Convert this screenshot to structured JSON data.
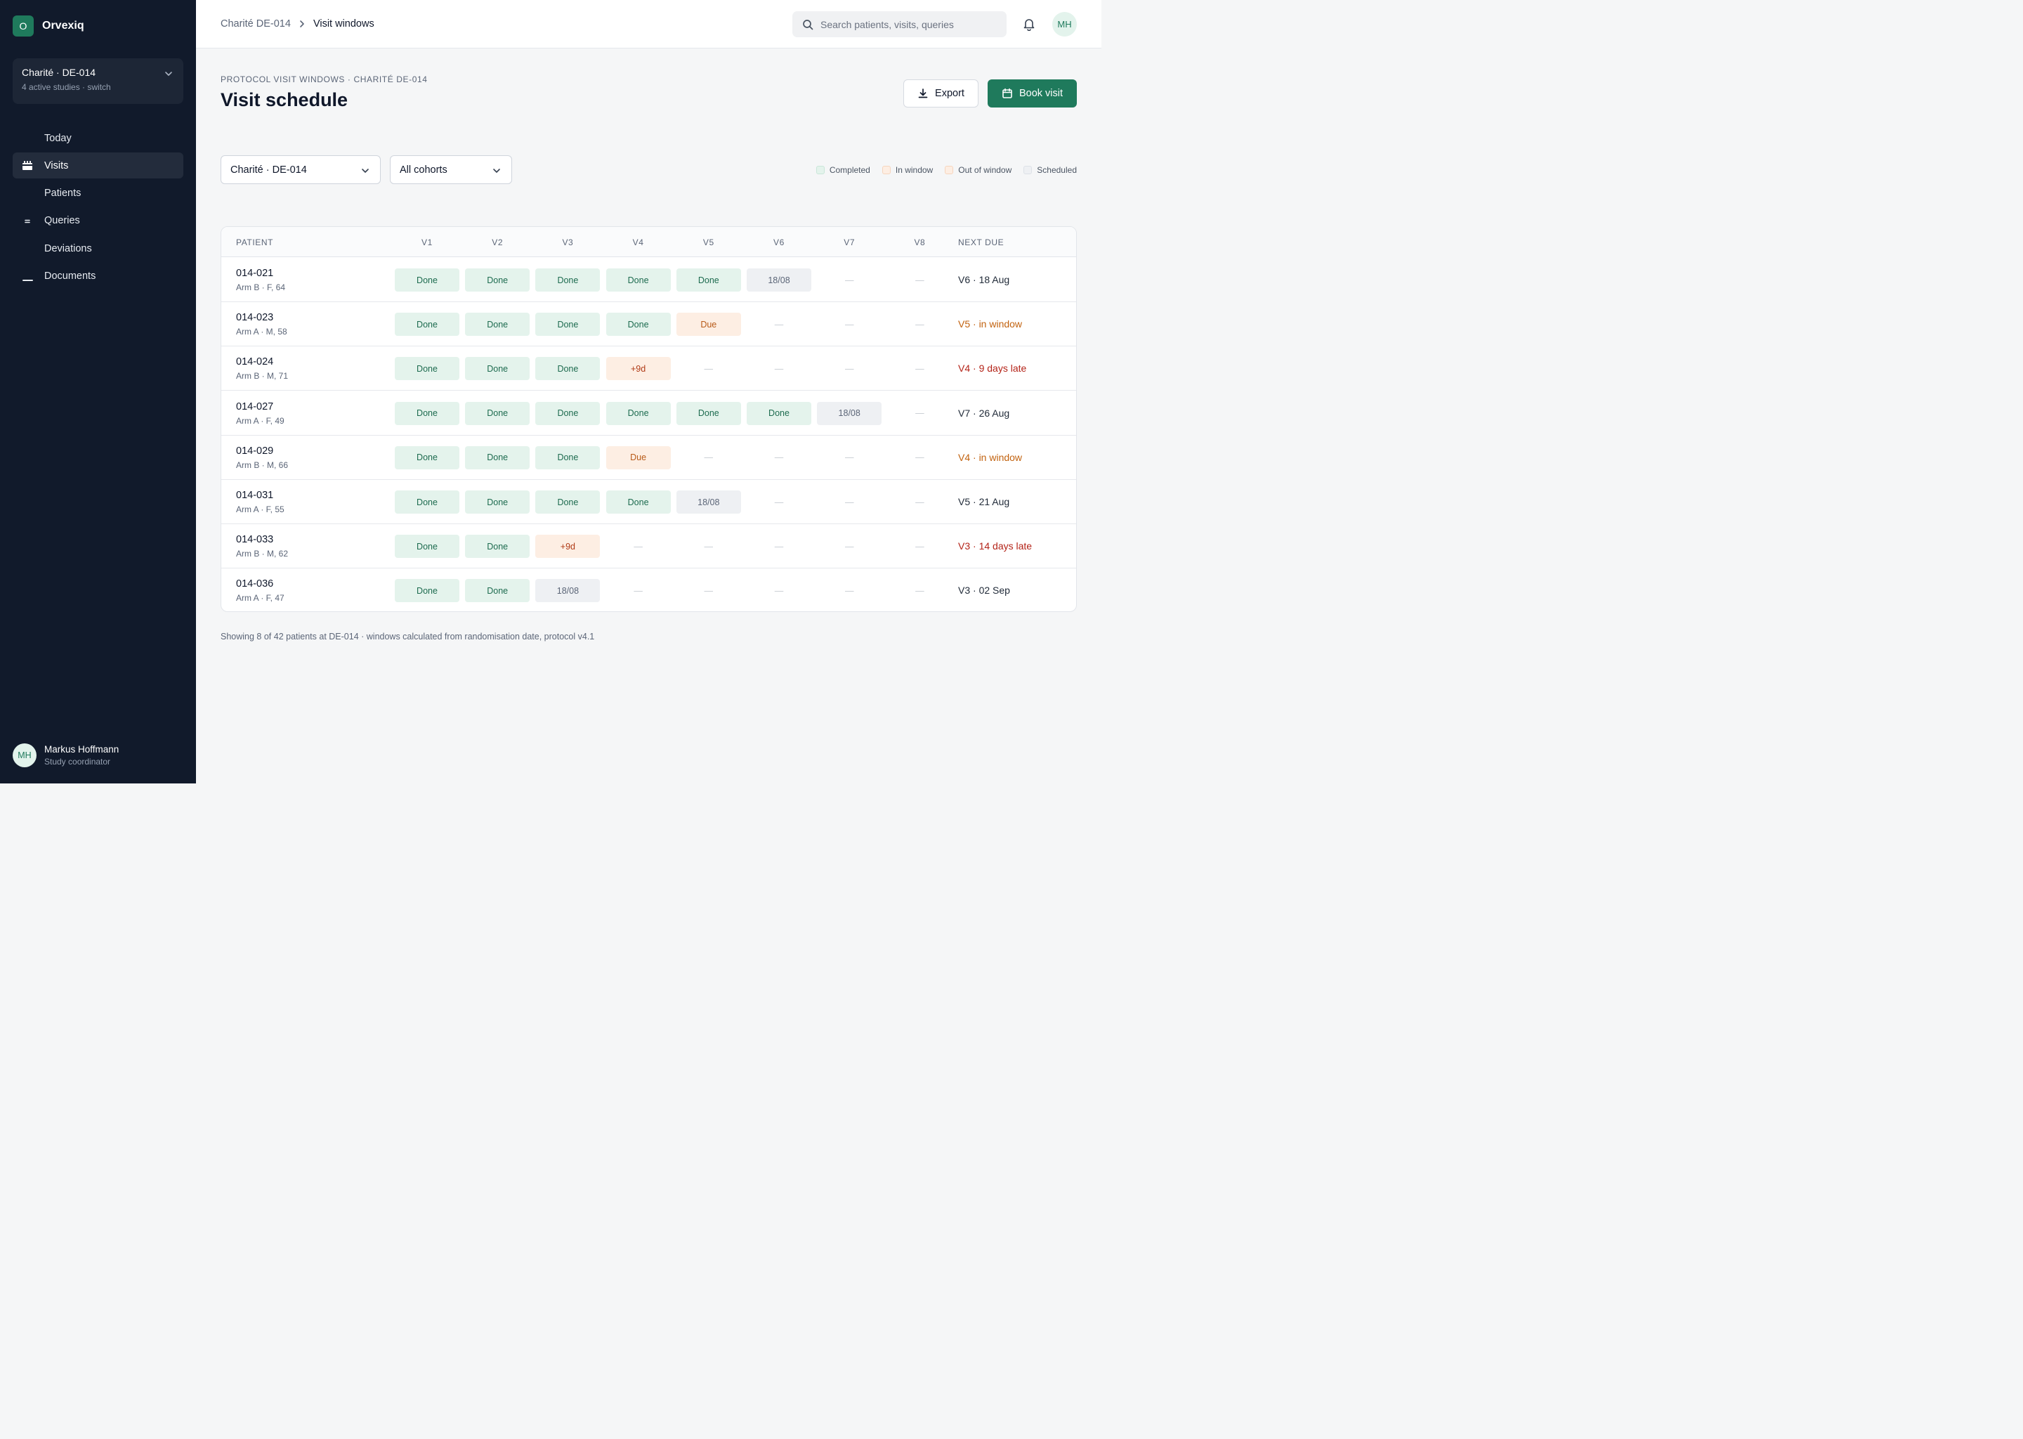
{
  "app": {
    "logo_letter": "O",
    "name": "Orvexiq"
  },
  "site_switcher": {
    "name": "Charité · DE-014",
    "subtitle": "4 active studies · switch"
  },
  "nav": [
    {
      "label": "Today",
      "icon": "",
      "active": false
    },
    {
      "label": "Visits",
      "icon": "calendar-icon",
      "active": true
    },
    {
      "label": "Patients",
      "icon": "",
      "active": false
    },
    {
      "label": "Queries",
      "icon": "equals-icon",
      "active": false
    },
    {
      "label": "Deviations",
      "icon": "",
      "active": false
    },
    {
      "label": "Documents",
      "icon": "underline-icon",
      "active": false
    }
  ],
  "user": {
    "initials": "MH",
    "name": "Markus Hoffmann",
    "role": "Study coordinator"
  },
  "topbar": {
    "breadcrumb_parent": "Charité DE-014",
    "breadcrumb_current": "Visit windows",
    "search_placeholder": "Search patients, visits, queries",
    "avatar_initials": "MH"
  },
  "page": {
    "eyebrow": "PROTOCOL VISIT WINDOWS · CHARITÉ DE-014",
    "title": "Visit schedule",
    "export_label": "Export",
    "book_label": "Book visit"
  },
  "filters": {
    "site": "Charité · DE-014",
    "cohort": "All cohorts"
  },
  "legend": [
    {
      "label": "Completed",
      "fill": "#e4f3ec",
      "border": "#c9e6d8"
    },
    {
      "label": "In window",
      "fill": "#fdeee3",
      "border": "#f6d5bd"
    },
    {
      "label": "Out of window",
      "fill": "#fdeee3",
      "border": "#f6d5bd"
    },
    {
      "label": "Scheduled",
      "fill": "#eef0f3",
      "border": "#dde1e7"
    }
  ],
  "table": {
    "headers": {
      "patient": "PATIENT",
      "visits": [
        "V1",
        "V2",
        "V3",
        "V4",
        "V5",
        "V6",
        "V7",
        "V8"
      ],
      "next_due": "NEXT DUE"
    },
    "rows": [
      {
        "id": "014-021",
        "meta": "Arm B · F, 64",
        "cells": [
          [
            "Done",
            "done"
          ],
          [
            "Done",
            "done"
          ],
          [
            "Done",
            "done"
          ],
          [
            "Done",
            "done"
          ],
          [
            "Done",
            "done"
          ],
          [
            "18/08",
            "sched"
          ],
          [
            "—",
            "none"
          ],
          [
            "—",
            "none"
          ]
        ],
        "next_due": "V6 · 18 Aug",
        "next_due_status": "normal"
      },
      {
        "id": "014-023",
        "meta": "Arm A · M, 58",
        "cells": [
          [
            "Done",
            "done"
          ],
          [
            "Done",
            "done"
          ],
          [
            "Done",
            "done"
          ],
          [
            "Done",
            "done"
          ],
          [
            "Due",
            "due"
          ],
          [
            "—",
            "none"
          ],
          [
            "—",
            "none"
          ],
          [
            "—",
            "none"
          ]
        ],
        "next_due": "V5 · in window",
        "next_due_status": "window"
      },
      {
        "id": "014-024",
        "meta": "Arm B · M, 71",
        "cells": [
          [
            "Done",
            "done"
          ],
          [
            "Done",
            "done"
          ],
          [
            "Done",
            "done"
          ],
          [
            "+9d",
            "late"
          ],
          [
            "—",
            "none"
          ],
          [
            "—",
            "none"
          ],
          [
            "—",
            "none"
          ],
          [
            "—",
            "none"
          ]
        ],
        "next_due": "V4 · 9 days late",
        "next_due_status": "late"
      },
      {
        "id": "014-027",
        "meta": "Arm A · F, 49",
        "cells": [
          [
            "Done",
            "done"
          ],
          [
            "Done",
            "done"
          ],
          [
            "Done",
            "done"
          ],
          [
            "Done",
            "done"
          ],
          [
            "Done",
            "done"
          ],
          [
            "Done",
            "done"
          ],
          [
            "18/08",
            "sched"
          ],
          [
            "—",
            "none"
          ]
        ],
        "next_due": "V7 · 26 Aug",
        "next_due_status": "normal"
      },
      {
        "id": "014-029",
        "meta": "Arm B · M, 66",
        "cells": [
          [
            "Done",
            "done"
          ],
          [
            "Done",
            "done"
          ],
          [
            "Done",
            "done"
          ],
          [
            "Due",
            "due"
          ],
          [
            "—",
            "none"
          ],
          [
            "—",
            "none"
          ],
          [
            "—",
            "none"
          ],
          [
            "—",
            "none"
          ]
        ],
        "next_due": "V4 · in window",
        "next_due_status": "window"
      },
      {
        "id": "014-031",
        "meta": "Arm A · F, 55",
        "cells": [
          [
            "Done",
            "done"
          ],
          [
            "Done",
            "done"
          ],
          [
            "Done",
            "done"
          ],
          [
            "Done",
            "done"
          ],
          [
            "18/08",
            "sched"
          ],
          [
            "—",
            "none"
          ],
          [
            "—",
            "none"
          ],
          [
            "—",
            "none"
          ]
        ],
        "next_due": "V5 · 21 Aug",
        "next_due_status": "normal"
      },
      {
        "id": "014-033",
        "meta": "Arm B · M, 62",
        "cells": [
          [
            "Done",
            "done"
          ],
          [
            "Done",
            "done"
          ],
          [
            "+9d",
            "late"
          ],
          [
            "—",
            "none"
          ],
          [
            "—",
            "none"
          ],
          [
            "—",
            "none"
          ],
          [
            "—",
            "none"
          ],
          [
            "—",
            "none"
          ]
        ],
        "next_due": "V3 · 14 days late",
        "next_due_status": "late"
      },
      {
        "id": "014-036",
        "meta": "Arm A · F, 47",
        "cells": [
          [
            "Done",
            "done"
          ],
          [
            "Done",
            "done"
          ],
          [
            "18/08",
            "sched"
          ],
          [
            "—",
            "none"
          ],
          [
            "—",
            "none"
          ],
          [
            "—",
            "none"
          ],
          [
            "—",
            "none"
          ],
          [
            "—",
            "none"
          ]
        ],
        "next_due": "V3 · 02 Sep",
        "next_due_status": "normal"
      }
    ]
  },
  "footnote": "Showing 8 of 42 patients at DE-014 · windows calculated from randomisation date, protocol v4.1"
}
